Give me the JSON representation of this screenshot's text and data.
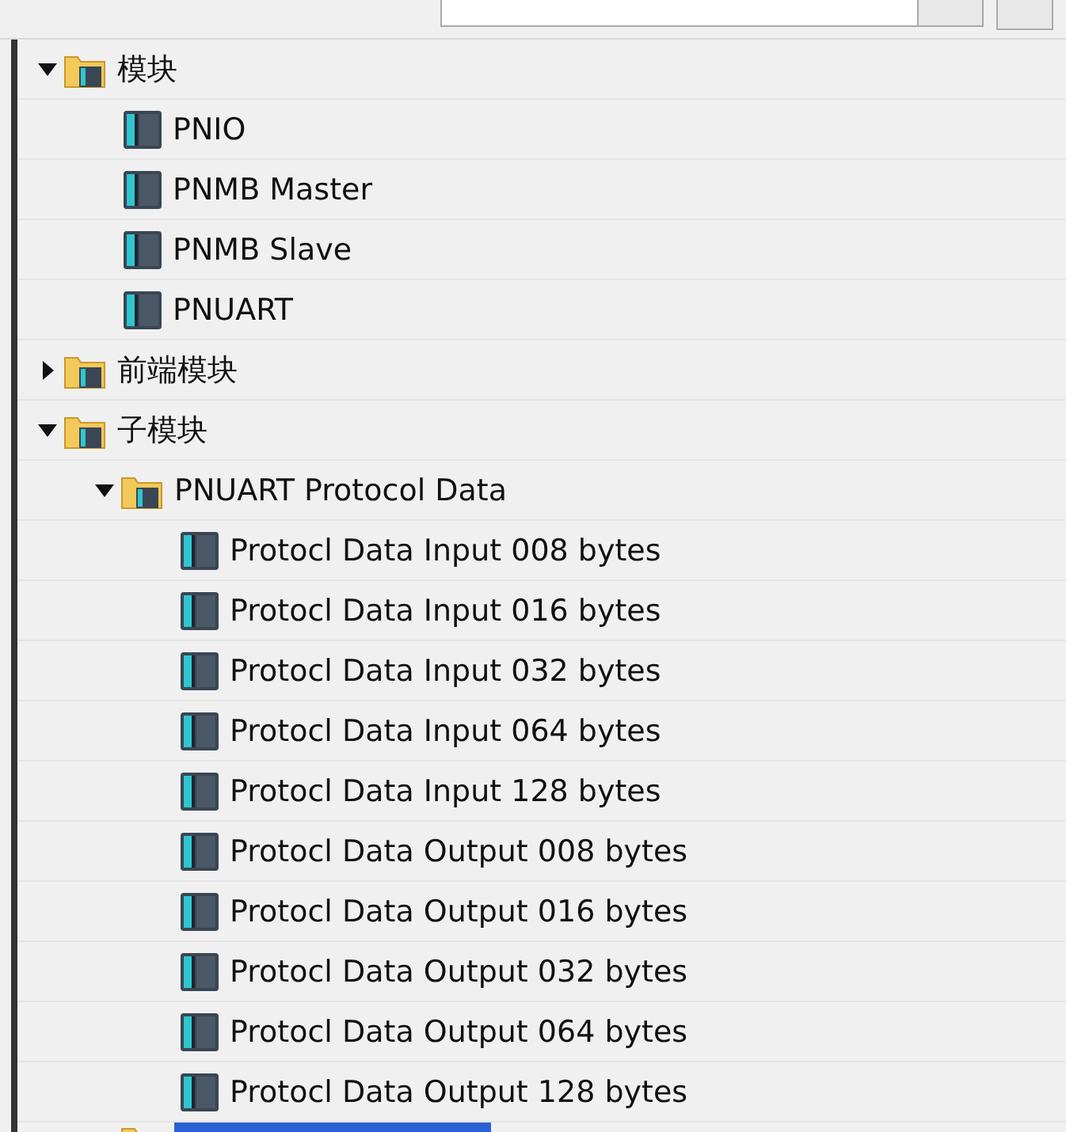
{
  "tree": [
    {
      "kind": "folder",
      "label": "模块",
      "expanded": true,
      "selected": false,
      "children": [
        {
          "kind": "module",
          "label": "PNIO",
          "selected": false
        },
        {
          "kind": "module",
          "label": "PNMB Master",
          "selected": false
        },
        {
          "kind": "module",
          "label": "PNMB Slave",
          "selected": false
        },
        {
          "kind": "module",
          "label": "PNUART",
          "selected": false
        }
      ]
    },
    {
      "kind": "folder",
      "label": "前端模块",
      "expanded": false,
      "selected": false
    },
    {
      "kind": "folder",
      "label": "子模块",
      "expanded": true,
      "selected": false,
      "children": [
        {
          "kind": "folder",
          "label": "PNUART Protocol Data",
          "expanded": true,
          "selected": false,
          "children": [
            {
              "kind": "module",
              "label": "Protocl Data Input 008 bytes",
              "selected": false
            },
            {
              "kind": "module",
              "label": "Protocl Data Input 016 bytes",
              "selected": false
            },
            {
              "kind": "module",
              "label": "Protocl Data Input 032 bytes",
              "selected": false
            },
            {
              "kind": "module",
              "label": "Protocl Data Input 064 bytes",
              "selected": false
            },
            {
              "kind": "module",
              "label": "Protocl Data Input 128 bytes",
              "selected": false
            },
            {
              "kind": "module",
              "label": "Protocl Data Output 008 bytes",
              "selected": false
            },
            {
              "kind": "module",
              "label": "Protocl Data Output 016 bytes",
              "selected": false
            },
            {
              "kind": "module",
              "label": "Protocl Data Output 032 bytes",
              "selected": false
            },
            {
              "kind": "module",
              "label": "Protocl Data Output 064 bytes",
              "selected": false
            },
            {
              "kind": "module",
              "label": "Protocl Data Output 128 bytes",
              "selected": false
            }
          ]
        },
        {
          "kind": "folder",
          "selected": true
        }
      ]
    }
  ]
}
